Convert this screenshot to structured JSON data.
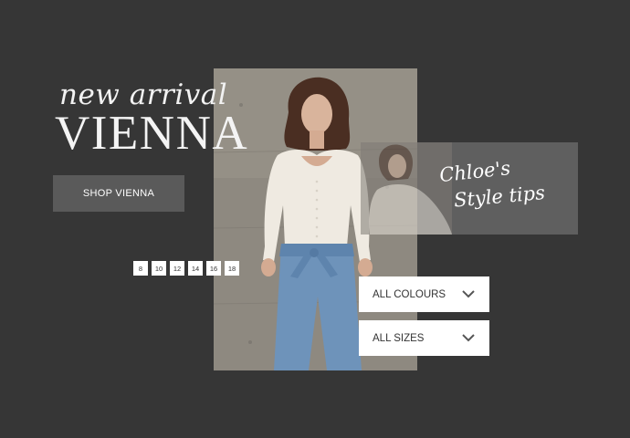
{
  "hero": {
    "script_title": "new arrival",
    "main_title": "VIENNA",
    "shop_button_label": "SHOP VIENNA"
  },
  "size_chips": [
    "8",
    "10",
    "12",
    "14",
    "16",
    "18"
  ],
  "style_tips": {
    "line1": "Chloe's",
    "line2": "Style tips"
  },
  "filters": {
    "colour_label": "ALL COLOURS",
    "size_label": "ALL SIZES"
  },
  "icons": {
    "dropdown": "chevron-down-icon"
  },
  "colors": {
    "background": "#363636",
    "button": "#5a5a5a",
    "card": "#5f5f5f",
    "text_light": "#ffffff",
    "text_dark": "#333333"
  }
}
